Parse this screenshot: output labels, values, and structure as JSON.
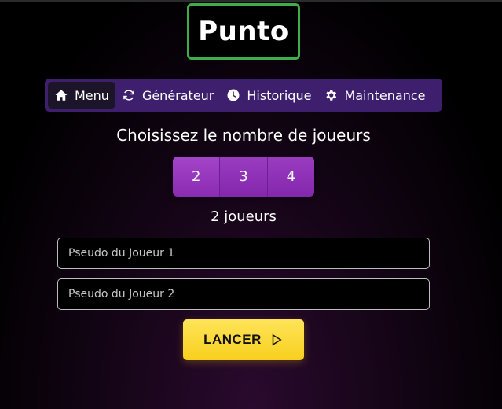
{
  "app": {
    "title": "Punto"
  },
  "nav": {
    "items": [
      {
        "label": "Menu",
        "icon": "home-icon",
        "active": true
      },
      {
        "label": "Générateur",
        "icon": "refresh-icon",
        "active": false
      },
      {
        "label": "Historique",
        "icon": "clock-icon",
        "active": false
      },
      {
        "label": "Maintenance",
        "icon": "gear-icon",
        "active": false
      }
    ]
  },
  "players": {
    "heading": "Choisissez le nombre de joueurs",
    "options": [
      "2",
      "3",
      "4"
    ],
    "selected": "2",
    "count_label": "2 joueurs"
  },
  "form": {
    "player1_placeholder": "Pseudo du Joueur 1",
    "player1_value": "",
    "player2_placeholder": "Pseudo du Joueur 2",
    "player2_value": ""
  },
  "launch": {
    "label": "LANCER",
    "icon": "play-icon"
  },
  "colors": {
    "logo_border": "#3fae4a",
    "nav_bg": "#3d1f6e",
    "player_button": "#8f30b6",
    "launch_button": "#f9d82b"
  }
}
